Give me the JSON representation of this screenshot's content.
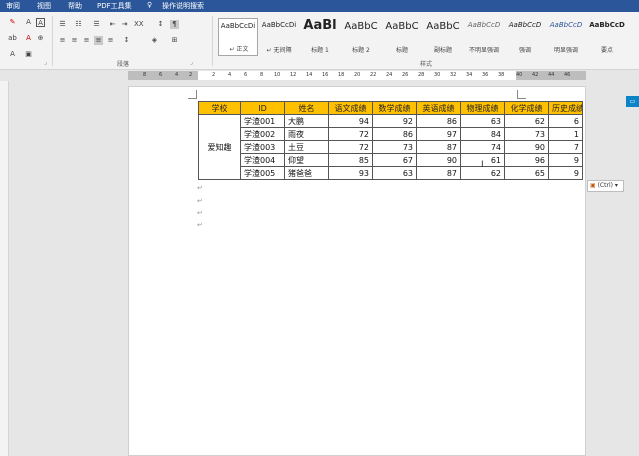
{
  "menu": [
    "审阅",
    "视图",
    "帮助",
    "PDF工具集",
    "操作说明搜索"
  ],
  "ribbon": {
    "paragraph_label": "段落",
    "styles_label": "样式",
    "styles": [
      {
        "preview": "AaBbCcDi",
        "name": "↵ 正文"
      },
      {
        "preview": "AaBbCcDi",
        "name": "↵ 无间隔"
      },
      {
        "preview": "AaBl",
        "name": "标题 1"
      },
      {
        "preview": "AaBbC",
        "name": "标题 2"
      },
      {
        "preview": "AaBbC",
        "name": "标题"
      },
      {
        "preview": "AaBbC",
        "name": "副标题"
      },
      {
        "preview": "AaBbCcD",
        "name": "不明显强调"
      },
      {
        "preview": "AaBbCcD",
        "name": "强调"
      },
      {
        "preview": "AaBbCcD",
        "name": "明显强调"
      },
      {
        "preview": "AaBbCcD",
        "name": "要点"
      }
    ]
  },
  "ruler_ticks": [
    "8",
    "6",
    "4",
    "2",
    "2",
    "4",
    "6",
    "8",
    "10",
    "12",
    "14",
    "16",
    "18",
    "20",
    "22",
    "24",
    "26",
    "28",
    "30",
    "32",
    "34",
    "36",
    "38",
    "40",
    "42",
    "44",
    "46"
  ],
  "table": {
    "headers": [
      "学校",
      "ID",
      "姓名",
      "语文成绩",
      "数学成绩",
      "英语成绩",
      "物理成绩",
      "化学成绩",
      "历史成绩"
    ],
    "school": "爱知趣",
    "rows": [
      {
        "id": "学渣001",
        "name": "大鹏",
        "scores": [
          "94",
          "92",
          "86",
          "63",
          "62",
          "6"
        ]
      },
      {
        "id": "学渣002",
        "name": "雨夜",
        "scores": [
          "72",
          "86",
          "97",
          "84",
          "73",
          "1"
        ]
      },
      {
        "id": "学渣003",
        "name": "土豆",
        "scores": [
          "72",
          "73",
          "87",
          "74",
          "90",
          "7"
        ]
      },
      {
        "id": "学渣004",
        "name": "仰望",
        "scores": [
          "85",
          "67",
          "90",
          "61",
          "96",
          "9"
        ]
      },
      {
        "id": "学渣005",
        "name": "猪爸爸",
        "scores": [
          "93",
          "63",
          "87",
          "62",
          "65",
          "9"
        ]
      }
    ]
  },
  "paragraph_mark": "↵",
  "paste_options": "(Ctrl)",
  "colors": {
    "title_bar": "#2b579a",
    "header_fill": "#ffc000",
    "side_tab": "#0a84c6"
  }
}
